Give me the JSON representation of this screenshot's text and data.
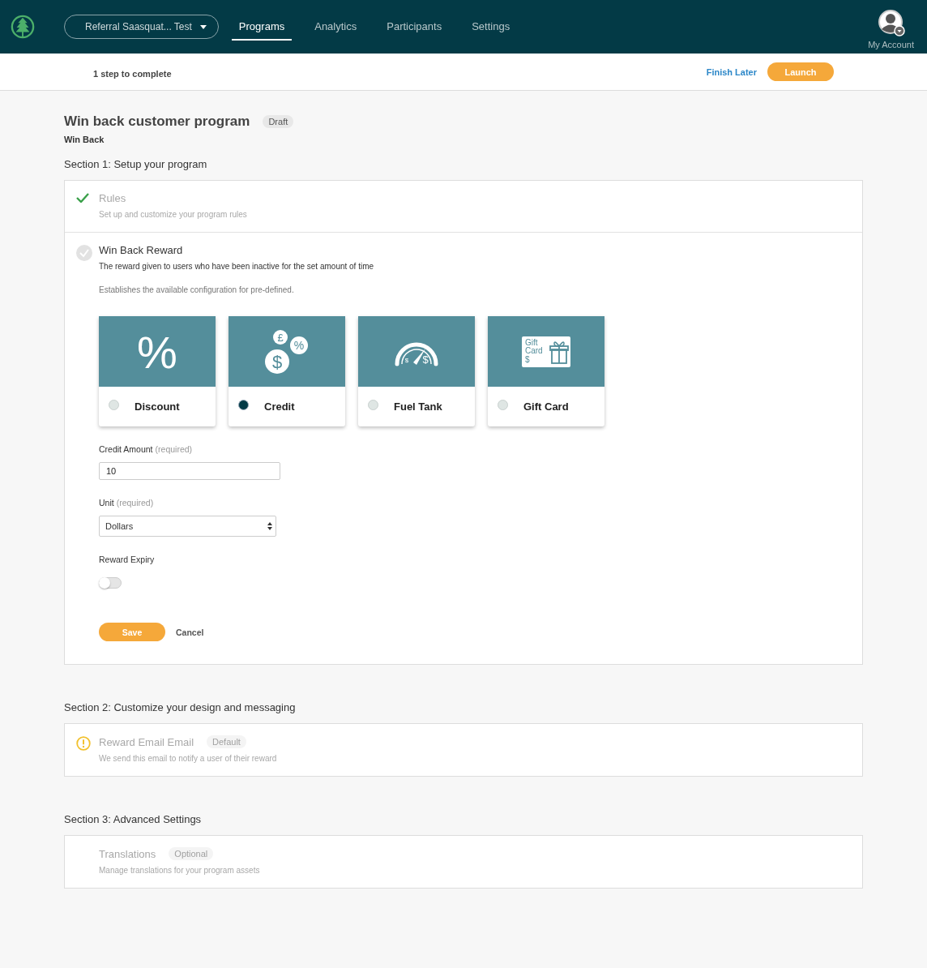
{
  "nav": {
    "workspace": "Referral Saasquat... Test",
    "tabs": [
      {
        "label": "Programs",
        "selected": true
      },
      {
        "label": "Analytics",
        "selected": false
      },
      {
        "label": "Participants",
        "selected": false
      },
      {
        "label": "Settings",
        "selected": false
      }
    ],
    "account": "My Account"
  },
  "progress": {
    "steps_text": "1 step to complete",
    "finish_later": "Finish Later",
    "launch": "Launch"
  },
  "program": {
    "title": "Win back customer program",
    "status": "Draft",
    "subtitle": "Win Back"
  },
  "sections": [
    {
      "title": "Section 1: Setup your program",
      "steps": [
        {
          "kind": "done",
          "expanded": false,
          "title": "Rules",
          "description": "Set up and customize your program rules"
        },
        {
          "kind": "pending",
          "expanded": true,
          "title": "Win Back Reward",
          "description": "The reward given to users who have been inactive for the set amount of time",
          "form": {
            "note": "Establishes the available configuration for pre-defined.",
            "reward_types": [
              {
                "kind": "percent",
                "label": "Discount",
                "selected": false,
                "glyphs": [
                  "%"
                ]
              },
              {
                "kind": "coins",
                "label": "Credit",
                "selected": true,
                "glyphs": [
                  "£",
                  "%",
                  "$"
                ]
              },
              {
                "kind": "gauge",
                "label": "Fuel Tank",
                "selected": false,
                "glyphs": [
                  "$",
                  "$"
                ]
              },
              {
                "kind": "giftcard",
                "label": "Gift Card",
                "selected": false,
                "glyphs": [
                  "Gift",
                  "Card",
                  "$"
                ]
              }
            ],
            "fields": [
              {
                "kind": "text",
                "label": "Credit Amount",
                "hint": "(required)",
                "value": "10"
              },
              {
                "kind": "select",
                "label": "Unit",
                "hint": "(required)",
                "value": "Dollars"
              },
              {
                "kind": "toggle",
                "label": "Reward Expiry",
                "on": false
              }
            ],
            "save": "Save",
            "cancel": "Cancel"
          }
        }
      ]
    },
    {
      "title": "Section 2: Customize your design and messaging",
      "steps": [
        {
          "kind": "warning",
          "expanded": false,
          "title": "Reward Email Email",
          "badge": "Default",
          "description": "We send this email to notify a user of their reward"
        }
      ]
    },
    {
      "title": "Section 3: Advanced Settings",
      "steps": [
        {
          "kind": "none",
          "expanded": false,
          "title": "Translations",
          "badge": "Optional",
          "description": "Manage translations for your program assets"
        }
      ]
    }
  ]
}
